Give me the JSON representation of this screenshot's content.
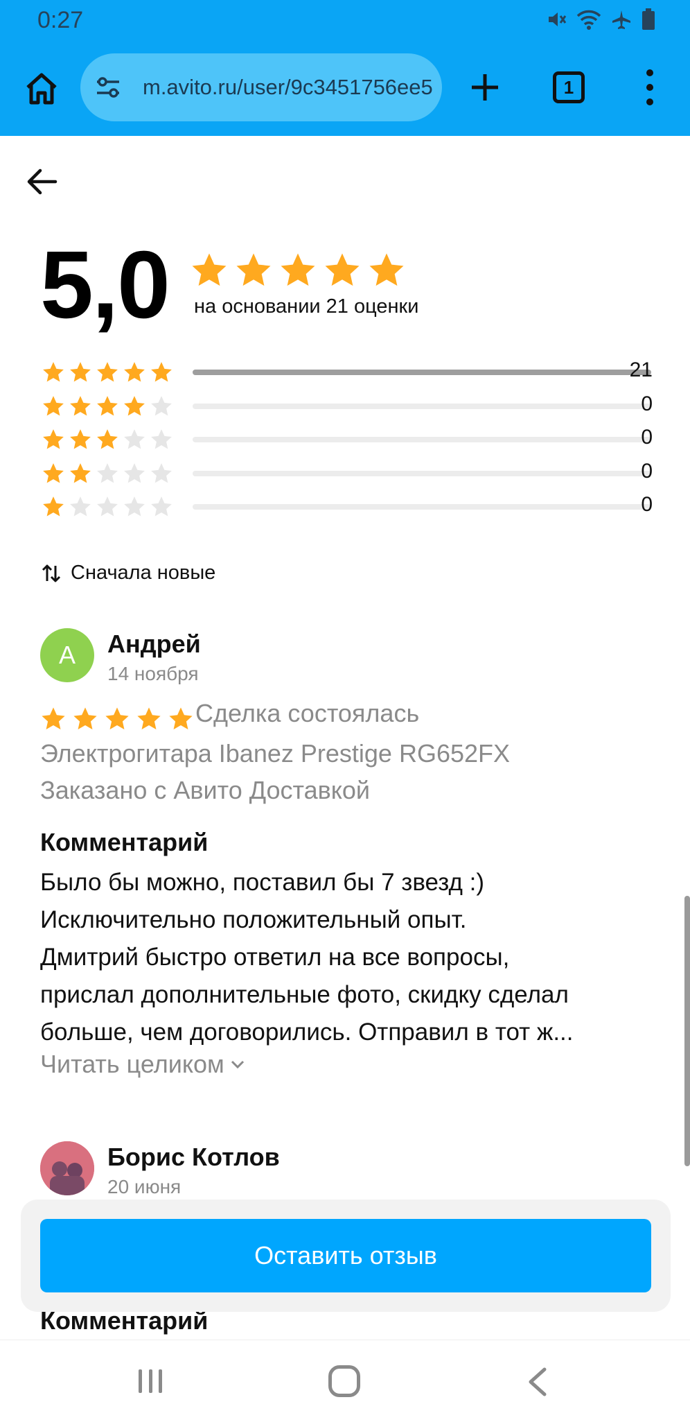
{
  "status_bar": {
    "time": "0:27"
  },
  "browser": {
    "url": "m.avito.ru/user/9c3451756ee5",
    "tab_count": "1",
    "icons": [
      "home-icon",
      "site-settings-icon",
      "plus-icon",
      "tabs-icon",
      "more-vert-icon"
    ]
  },
  "rating": {
    "value": "5,0",
    "basis": "на основании 21 оценки",
    "stars": 5,
    "distribution": [
      {
        "stars": 5,
        "count": "21",
        "fraction": 1.0
      },
      {
        "stars": 4,
        "count": "0",
        "fraction": 0
      },
      {
        "stars": 3,
        "count": "0",
        "fraction": 0
      },
      {
        "stars": 2,
        "count": "0",
        "fraction": 0
      },
      {
        "stars": 1,
        "count": "0",
        "fraction": 0
      }
    ]
  },
  "sort": {
    "label": "Сначала новые"
  },
  "reviews": [
    {
      "avatar_letter": "А",
      "avatar_color": "#8fd14f",
      "name": "Андрей",
      "date": "14 ноября",
      "stars": 5,
      "deal": "Сделка состоялась",
      "item": "Электрогитара Ibanez Prestige RG652FX",
      "delivery": "Заказано с Авито Доставкой",
      "comment_title": "Комментарий",
      "comment_lines": [
        "Было бы можно, поставил бы 7 звезд :)",
        "Исключительно положительный опыт.",
        "Дмитрий быстро ответил на все вопросы,",
        "прислал дополнительные фото, скидку сделал",
        "больше, чем договорились. Отправил в тот ж..."
      ],
      "read_more": "Читать целиком"
    },
    {
      "avatar_color": "#d9707f",
      "name": "Борис Котлов",
      "date": "20 июня",
      "comment_title": "Комментарий"
    }
  ],
  "cta": {
    "label": "Оставить отзыв"
  },
  "colors": {
    "chrome": "#0aa5f5",
    "star": "#ffa91f",
    "star_empty": "#e6e6e6",
    "button": "#00a6fe"
  }
}
